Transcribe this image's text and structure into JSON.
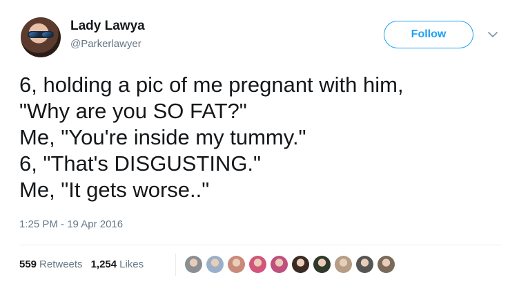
{
  "user": {
    "name": "Lady Lawya",
    "handle": "@Parkerlawyer",
    "follow_label": "Follow"
  },
  "tweet": {
    "text": "6, holding a pic of me pregnant with him,\n\"Why are you SO FAT?\"\nMe, \"You're inside my tummy.\"\n6, \"That's DISGUSTING.\"\nMe, \"It gets worse..\"",
    "timestamp": "1:25 PM - 19 Apr 2016"
  },
  "stats": {
    "retweets_count": "559",
    "retweets_label": "Retweets",
    "likes_count": "1,254",
    "likes_label": "Likes"
  },
  "likers": [
    {
      "icon": "cat-avatar-icon",
      "color": "#8a8f93"
    },
    {
      "icon": "person-avatar-icon",
      "color": "#9bb0c8"
    },
    {
      "icon": "person-avatar-icon",
      "color": "#c98a7a"
    },
    {
      "icon": "person-avatar-icon",
      "color": "#d2567a"
    },
    {
      "icon": "person-avatar-icon",
      "color": "#c0507e"
    },
    {
      "icon": "person-avatar-icon",
      "color": "#3a2a22"
    },
    {
      "icon": "person-avatar-icon",
      "color": "#2f3a2a"
    },
    {
      "icon": "person-avatar-icon",
      "color": "#b59d86"
    },
    {
      "icon": "person-avatar-icon",
      "color": "#555555"
    },
    {
      "icon": "person-avatar-icon",
      "color": "#7a6a5a"
    }
  ]
}
